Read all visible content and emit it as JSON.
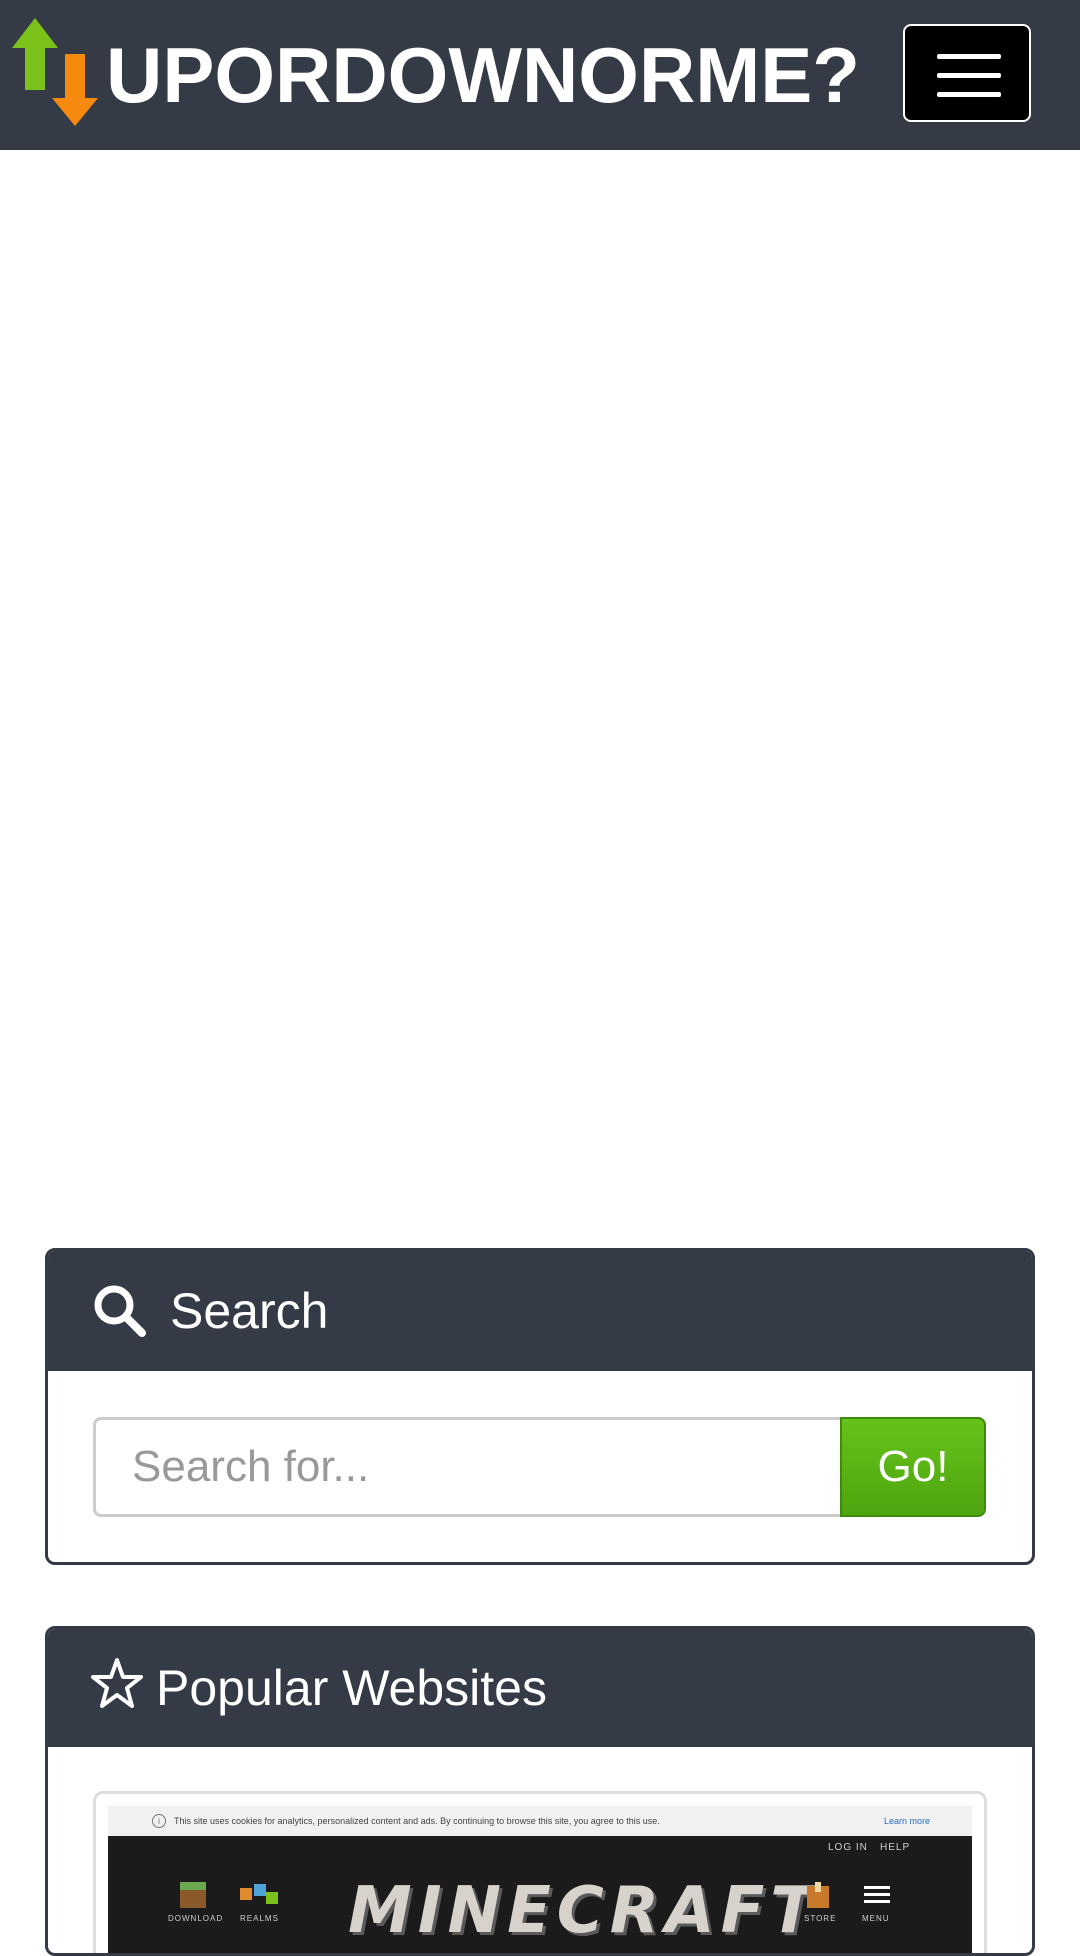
{
  "header": {
    "brand": "UPORDOWNORME?",
    "logo_icon": "up-down-arrows-icon",
    "menu_icon": "hamburger-icon"
  },
  "search_card": {
    "title": "Search",
    "icon": "search-icon",
    "placeholder": "Search for...",
    "go_label": "Go!"
  },
  "popular_card": {
    "title": "Popular Websites",
    "icon": "star-icon",
    "thumbnail": {
      "cookie_text": "This site uses cookies for analytics, personalized content and ads. By continuing to browse this site, you agree to this use.",
      "cookie_link": "Learn more",
      "top_links": [
        "LOG IN",
        "HELP"
      ],
      "logo_text": "MINECRAFT",
      "nav_labels": [
        "DOWNLOAD",
        "REALMS",
        "STORE",
        "MENU"
      ]
    }
  },
  "colors": {
    "header_bg": "#343a46",
    "go_button": "#5cb615",
    "arrow_up": "#7ac21a",
    "arrow_down": "#f58a0e"
  }
}
